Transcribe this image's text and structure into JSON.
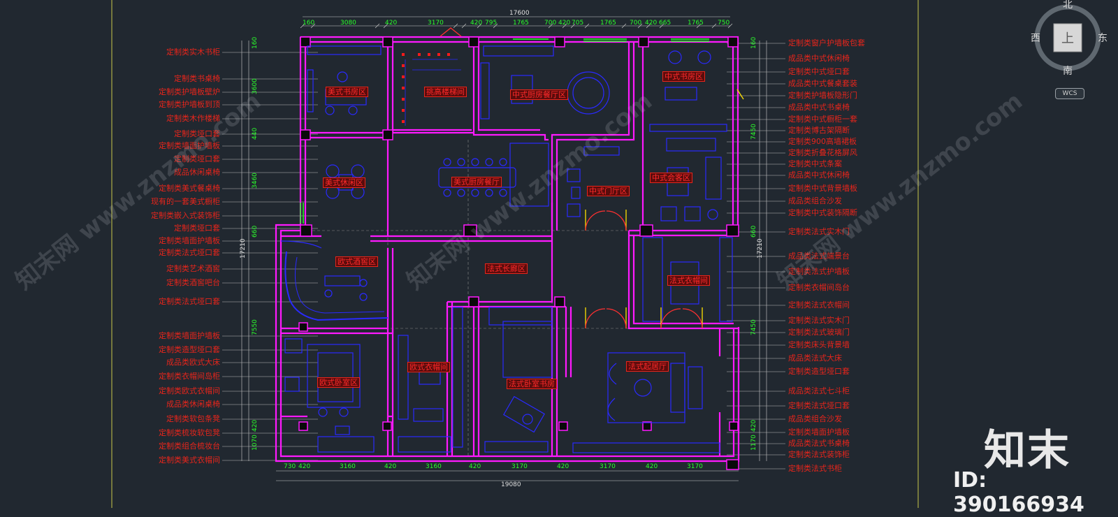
{
  "title_dims": {
    "top_total": "17600",
    "top_segments": [
      "160",
      "3080",
      "420",
      "3170",
      "420",
      "795",
      "1765",
      "700",
      "420",
      "705",
      "1765",
      "700",
      "420",
      "665",
      "1765",
      "750"
    ],
    "bottom_total": "19080",
    "bottom_segments": [
      "730",
      "420",
      "3160",
      "420",
      "3160",
      "420",
      "3170",
      "420",
      "3170",
      "420",
      "3170"
    ],
    "left_total": "17210",
    "left_segments": [
      "160",
      "3600",
      "440",
      "3460",
      "660",
      "7550",
      "420",
      "1070"
    ],
    "right_total": "17210",
    "right_segments": [
      "160",
      "7450",
      "660",
      "7450",
      "420",
      "1170"
    ]
  },
  "rooms": [
    {
      "id": "r1",
      "text": "美式书房区"
    },
    {
      "id": "r2",
      "text": "挑高楼梯间"
    },
    {
      "id": "r3",
      "text": "中式厨房餐厅区"
    },
    {
      "id": "r4",
      "text": "中式书房区"
    },
    {
      "id": "r5",
      "text": "美式休闲区"
    },
    {
      "id": "r6",
      "text": "美式厨房餐厅"
    },
    {
      "id": "r7",
      "text": "中式门厅区"
    },
    {
      "id": "r8",
      "text": "中式会客区"
    },
    {
      "id": "r9",
      "text": "欧式酒窖区"
    },
    {
      "id": "r10",
      "text": "法式长廊区"
    },
    {
      "id": "r11",
      "text": "法式衣帽间"
    },
    {
      "id": "r12",
      "text": "欧式衣帽间"
    },
    {
      "id": "r13",
      "text": "欧式卧室区"
    },
    {
      "id": "r14",
      "text": "法式卧室书房"
    },
    {
      "id": "r15",
      "text": "法式起居厅"
    }
  ],
  "left_labels": [
    "定制类实木书柜",
    "定制类书桌椅",
    "定制类护墙板壁炉",
    "定制类护墙板到顶",
    "定制类木作楼梯",
    "定制类垭口套",
    "定制类墙面护墙板",
    "定制类垭口套",
    "成品休闲桌椅",
    "定制类美式餐桌椅",
    "现有的一套美式橱柜",
    "定制类嵌入式装饰柜",
    "定制类垭口套",
    "定制类墙面护墙板",
    "定制类法式垭口套",
    "定制类艺术酒窖",
    "定制类酒窖吧台",
    "定制类法式垭口套",
    "定制类墙面护墙板",
    "定制类造型垭口套",
    "成品类欧式大床",
    "定制类衣帽间岛柜",
    "定制类欧式衣帽间",
    "成品类休闲桌椅",
    "定制类软包条凳",
    "定制类梳妆软包凳",
    "定制类组合梳妆台",
    "定制类美式衣帽间"
  ],
  "right_labels": [
    "定制类窗户护墙板包套",
    "成品类中式休闲椅",
    "定制类中式垭口套",
    "成品类中式餐桌套装",
    "定制类护墙板隐形门",
    "成品类中式书桌椅",
    "定制类中式橱柜一套",
    "定制类博古架隔断",
    "定制类900高墙裙板",
    "定制类折叠花格屏风",
    "定制类中式条案",
    "成品类中式休闲椅",
    "定制类中式背景墙板",
    "成品类组合沙发",
    "定制类中式装饰隔断",
    "定制类法式实木门",
    "成品类法式端景台",
    "定制类法式护墙板",
    "定制类衣帽间岛台",
    "定制类法式衣帽间",
    "定制类法式实木门",
    "定制类法式玻璃门",
    "定制类床头背景墙",
    "成品类法式大床",
    "定制类造型垭口套",
    "成品类法式七斗柜",
    "定制类法式垭口套",
    "成品类组合沙发",
    "定制类墙面护墙板",
    "成品类法式书桌椅",
    "定制类法式装饰柜",
    "定制类法式书柜"
  ],
  "compass": {
    "north": "北",
    "south": "南",
    "east": "东",
    "west": "西",
    "ucs": "WCS"
  },
  "watermark": "知末网 www.znzmo.com",
  "brand": "知末",
  "id_text": "ID: 390166934",
  "colors": {
    "background": "#212830",
    "wall": "#ff19ff",
    "furniture": "#2a2aff",
    "text_red": "#e8251b",
    "dim_green": "#2bff2b",
    "door_yellow": "#ffe000"
  }
}
